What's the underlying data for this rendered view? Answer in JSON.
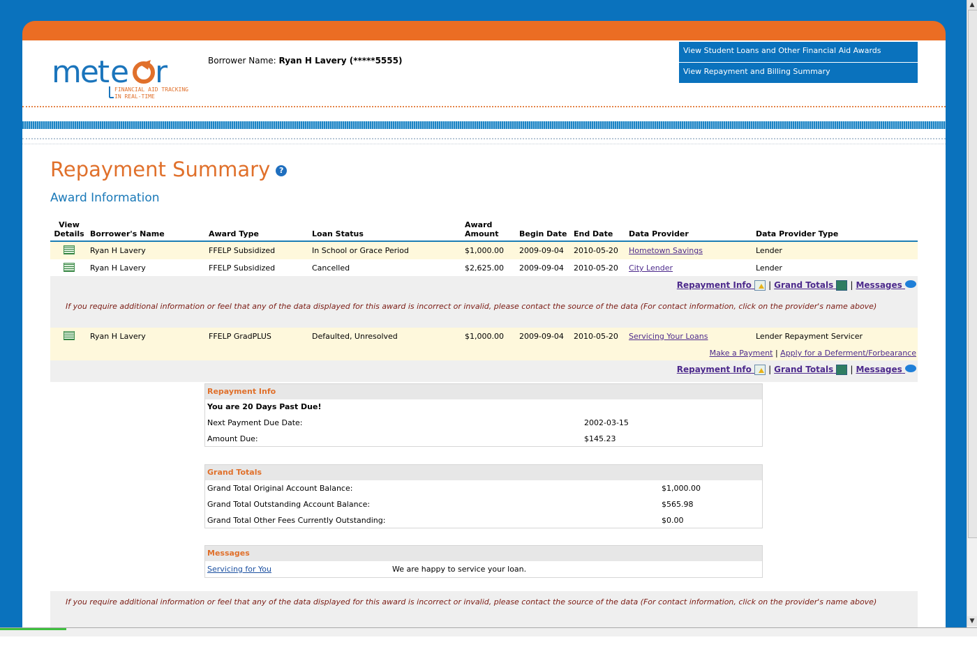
{
  "header": {
    "logo_text": "meteor",
    "logo_tagline_1": "FINANCIAL AID TRACKING",
    "logo_tagline_2": "IN REAL-TIME",
    "borrower_label": "Borrower Name:",
    "borrower_value": "Ryan H Lavery (*****5555)"
  },
  "topnav": {
    "items": [
      {
        "label": "View Student Loans and Other Financial Aid Awards"
      },
      {
        "label": "View Repayment and Billing Summary"
      }
    ]
  },
  "page_title": "Repayment Summary",
  "help_icon": "?",
  "section_title": "Award Information",
  "table": {
    "headers": {
      "view": "View",
      "details": "Details",
      "name": "Borrower's Name",
      "award_type": "Award Type",
      "loan_status": "Loan Status",
      "award": "Award",
      "amount": "Amount",
      "begin": "Begin Date",
      "end": "End Date",
      "provider": "Data Provider",
      "provider_type": "Data Provider Type"
    },
    "rows": [
      {
        "name": "Ryan H Lavery",
        "award_type": "FFELP Subsidized",
        "status": "In School or Grace Period",
        "amount": "$1,000.00",
        "begin": "2009-09-04",
        "end": "2010-05-20",
        "provider": "Hometown Savings",
        "provider_type": "Lender"
      },
      {
        "name": "Ryan H Lavery",
        "award_type": "FFELP Subsidized",
        "status": "Cancelled",
        "amount": "$2,625.00",
        "begin": "2009-09-04",
        "end": "2010-05-20",
        "provider": "City Lender",
        "provider_type": "Lender"
      },
      {
        "name": "Ryan H Lavery",
        "award_type": "FFELP GradPLUS",
        "status": "Defaulted, Unresolved",
        "amount": "$1,000.00",
        "begin": "2009-09-04",
        "end": "2010-05-20",
        "provider": "Servicing Your Loans",
        "provider_type": "Lender Repayment Servicer"
      }
    ]
  },
  "links": {
    "repayment_info": "Repayment Info",
    "grand_totals": "Grand Totals",
    "messages": "Messages",
    "sep": "|",
    "make_payment": "Make a Payment",
    "deferment": "Apply for a Deferment/Forbearance"
  },
  "notice": "If you require additional information or feel that any of the data displayed for this award is incorrect or invalid, please contact the source of the data (For contact information, click on the provider's name above)",
  "repayment_panel": {
    "title": "Repayment Info",
    "alert": "You are 20 Days Past Due!",
    "next_due_label": "Next Payment Due Date:",
    "next_due_value": "2002-03-15",
    "amount_due_label": "Amount Due:",
    "amount_due_value": "$145.23"
  },
  "totals_panel": {
    "title": "Grand Totals",
    "rows": [
      {
        "label": "Grand Total Original Account Balance:",
        "value": "$1,000.00"
      },
      {
        "label": "Grand Total Outstanding Account Balance:",
        "value": "$565.98"
      },
      {
        "label": "Grand Total Other Fees Currently Outstanding:",
        "value": "$0.00"
      }
    ]
  },
  "messages_panel": {
    "title": "Messages",
    "sender": "Servicing for You",
    "message": "We are happy to service your loan."
  },
  "colors": {
    "brand_blue": "#0a72bd",
    "brand_orange": "#eb6d23",
    "title_orange": "#e0702b",
    "highlight_row": "#fef8dc"
  }
}
